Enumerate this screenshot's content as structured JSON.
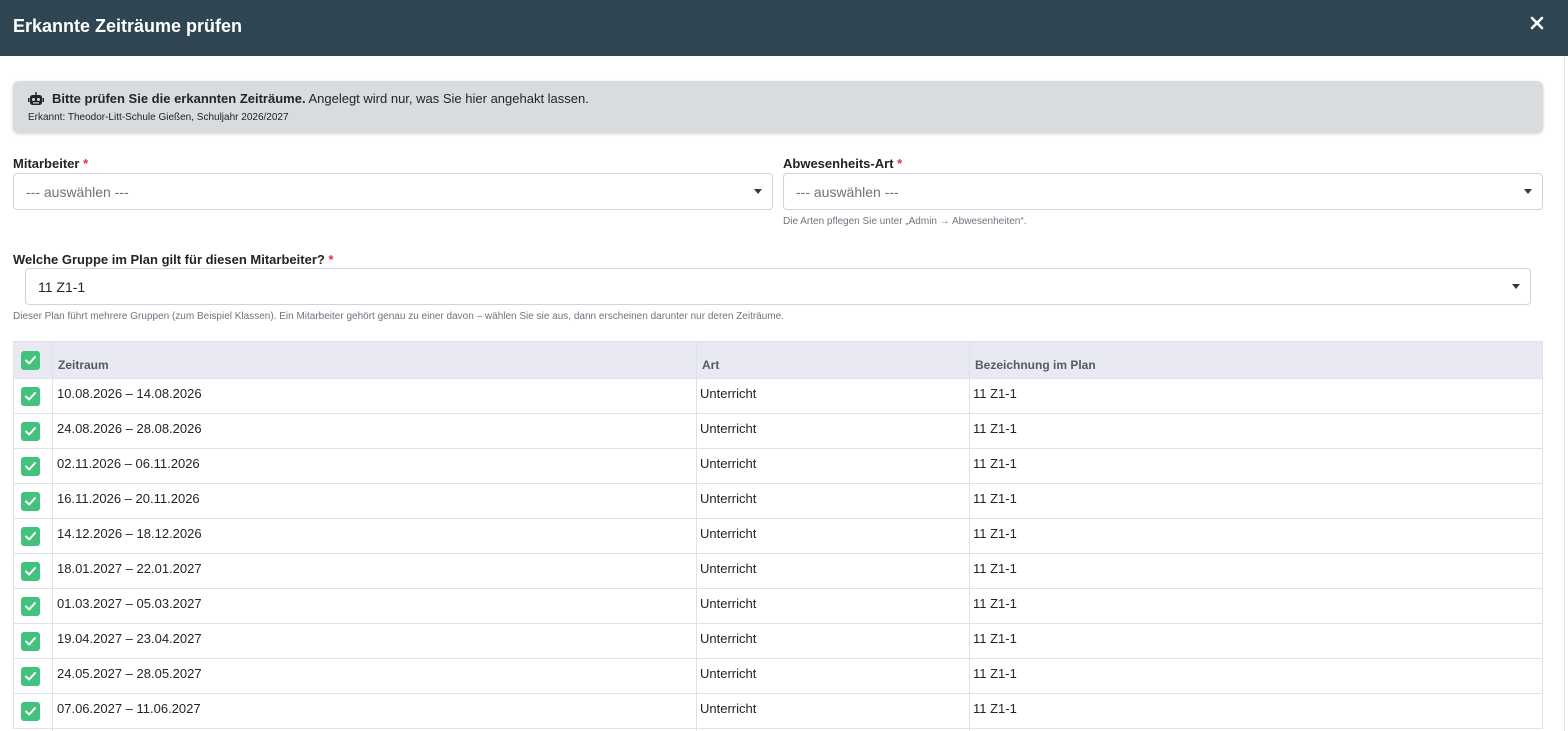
{
  "modal": {
    "title": "Erkannte Zeiträume prüfen"
  },
  "alert": {
    "bold_text": "Bitte prüfen Sie die erkannten Zeiträume.",
    "text": "Angelegt wird nur, was Sie hier angehakt lassen.",
    "recognized": "Erkannt: Theodor-Litt-Schule Gießen, Schuljahr 2026/2027"
  },
  "form": {
    "employee": {
      "label": "Mitarbeiter",
      "required_marker": "*",
      "value": "--- auswählen ---"
    },
    "absence_type": {
      "label": "Abwesenheits-Art",
      "required_marker": "*",
      "value": "--- auswählen ---",
      "hint": "Die Arten pflegen Sie unter „Admin → Abwesenheiten“."
    },
    "group": {
      "label": "Welche Gruppe im Plan gilt für diesen Mitarbeiter?",
      "required_marker": "*",
      "value": "11 Z1-1",
      "hint": "Dieser Plan führt mehrere Gruppen (zum Beispiel Klassen). Ein Mitarbeiter gehört genau zu einer davon – wählen Sie sie aus, dann erscheinen darunter nur deren Zeiträume."
    }
  },
  "table": {
    "headers": [
      "Zeitraum",
      "Art",
      "Bezeichnung im Plan"
    ],
    "select_all_checked": true,
    "rows": [
      {
        "period": "10.08.2026 – 14.08.2026",
        "type": "Unterricht",
        "label": "11 Z1-1",
        "checked": true
      },
      {
        "period": "24.08.2026 – 28.08.2026",
        "type": "Unterricht",
        "label": "11 Z1-1",
        "checked": true
      },
      {
        "period": "02.11.2026 – 06.11.2026",
        "type": "Unterricht",
        "label": "11 Z1-1",
        "checked": true
      },
      {
        "period": "16.11.2026 – 20.11.2026",
        "type": "Unterricht",
        "label": "11 Z1-1",
        "checked": true
      },
      {
        "period": "14.12.2026 – 18.12.2026",
        "type": "Unterricht",
        "label": "11 Z1-1",
        "checked": true
      },
      {
        "period": "18.01.2027 – 22.01.2027",
        "type": "Unterricht",
        "label": "11 Z1-1",
        "checked": true
      },
      {
        "period": "01.03.2027 – 05.03.2027",
        "type": "Unterricht",
        "label": "11 Z1-1",
        "checked": true
      },
      {
        "period": "19.04.2027 – 23.04.2027",
        "type": "Unterricht",
        "label": "11 Z1-1",
        "checked": true
      },
      {
        "period": "24.05.2027 – 28.05.2027",
        "type": "Unterricht",
        "label": "11 Z1-1",
        "checked": true
      },
      {
        "period": "07.06.2027 – 11.06.2027",
        "type": "Unterricht",
        "label": "11 Z1-1",
        "checked": true
      }
    ]
  },
  "colors": {
    "header_bg": "#2f4552",
    "checkbox": "#43c27e",
    "required": "#dc3545"
  }
}
